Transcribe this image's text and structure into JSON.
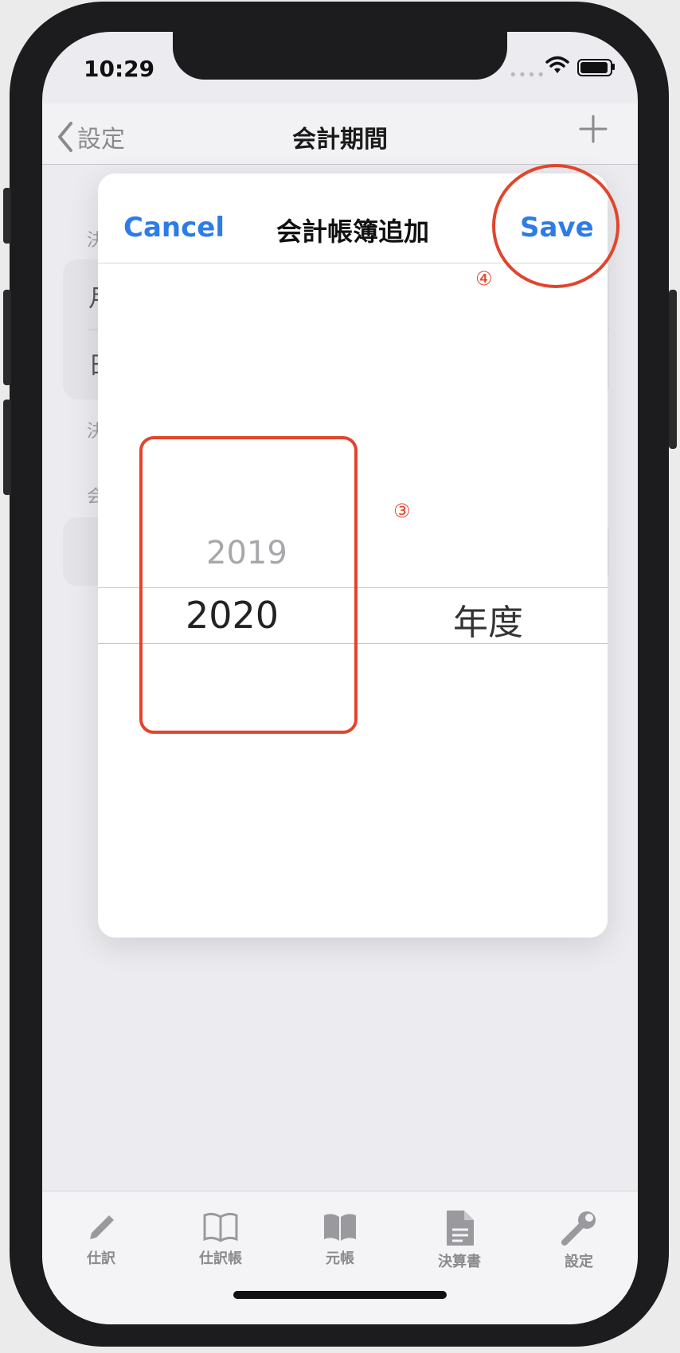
{
  "status": {
    "time": "10:29"
  },
  "navbar": {
    "back_label": "設定",
    "title": "会計期間"
  },
  "background": {
    "section1_label": "決",
    "row1_text": "月",
    "row2_text": "日",
    "section2_label": "決",
    "section3_label": "会"
  },
  "modal": {
    "cancel_label": "Cancel",
    "title": "会計帳簿追加",
    "save_label": "Save",
    "picker": {
      "previous_year": "2019",
      "selected_year": "2020",
      "unit": "年度"
    }
  },
  "annotations": {
    "step3": "③",
    "step4": "④"
  },
  "tabbar": {
    "items": [
      {
        "label": "仕訳",
        "icon": "pencil-icon"
      },
      {
        "label": "仕訳帳",
        "icon": "open-book-outline-icon"
      },
      {
        "label": "元帳",
        "icon": "book-filled-icon"
      },
      {
        "label": "決算書",
        "icon": "document-icon"
      },
      {
        "label": "設定",
        "icon": "wrench-icon"
      }
    ]
  },
  "colors": {
    "accent": "#2d7ce8",
    "annotation": "#e1452c"
  }
}
